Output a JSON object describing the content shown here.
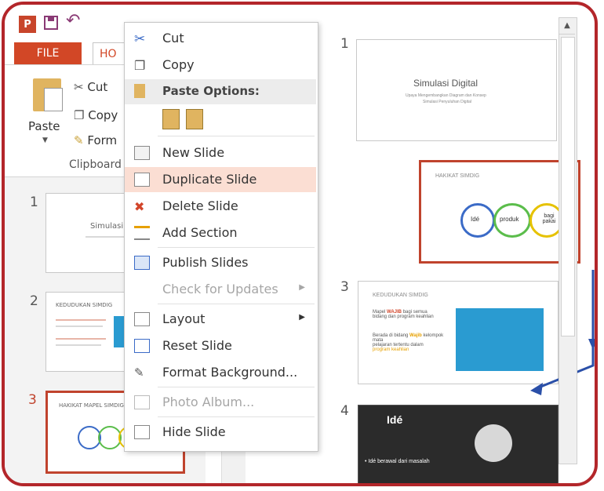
{
  "quick_access": {
    "logo": "P",
    "undo": "↶"
  },
  "tabs": {
    "file": "FILE",
    "home": "HO"
  },
  "ribbon": {
    "paste": "Paste",
    "cut": "Cut",
    "copy": "Copy",
    "format": "Form",
    "group": "Clipboard"
  },
  "left_thumbs": [
    {
      "num": "1",
      "title": "Simulasi D"
    },
    {
      "num": "2",
      "title": "KEDUDUKAN SIMDIG"
    },
    {
      "num": "3",
      "title": "HAKIKAT MAPEL SIMDIG"
    }
  ],
  "context_menu": {
    "items": [
      {
        "label": "Cut",
        "icon": "scissors-icon"
      },
      {
        "label": "Copy",
        "icon": "copy-icon"
      },
      {
        "label": "Paste Options:",
        "icon": "clipboard-icon"
      },
      {
        "label": "New Slide",
        "icon": "new-slide-icon"
      },
      {
        "label": "Duplicate Slide",
        "icon": "duplicate-slide-icon"
      },
      {
        "label": "Delete Slide",
        "icon": "delete-slide-icon"
      },
      {
        "label": "Add Section",
        "icon": "add-section-icon"
      },
      {
        "label": "Publish Slides",
        "icon": "publish-slides-icon"
      },
      {
        "label": "Check for Updates",
        "icon": ""
      },
      {
        "label": "Layout",
        "icon": "layout-icon"
      },
      {
        "label": "Reset Slide",
        "icon": "reset-slide-icon"
      },
      {
        "label": "Format Background...",
        "icon": "format-background-icon"
      },
      {
        "label": "Photo Album...",
        "icon": "photo-album-icon"
      },
      {
        "label": "Hide Slide",
        "icon": "hide-slide-icon"
      }
    ]
  },
  "right_slides": {
    "s1": {
      "num": "1",
      "title": "Simulasi Digital",
      "sub": "Upaya Mengembangkan Diagram dan Konsep",
      "sub2": "Simulasi Penyuluhan Digital"
    },
    "dup": {
      "title": "HAKIKAT SIMDIG",
      "c1": "Idé",
      "c2": "produk",
      "c3": "bagi pakai"
    },
    "s3": {
      "num": "3",
      "title": "KEDUDUKAN SIMDIG",
      "b1a": "Mapel ",
      "b1b": "WAJIB",
      "b1c": " bagi semua",
      "b1d": "bidang dan program keahlian",
      "b2a": "Berada di bidang ",
      "b2b": "Wajib",
      "b2c": "kelompok mata",
      "b2d": "pelajaran tertentu dalam",
      "b2e": "program keahlian"
    },
    "s4": {
      "num": "4",
      "title": "Idé",
      "bullet": "• Idé berawal dari masalah"
    }
  },
  "colors": {
    "accent": "#c0432d",
    "arrow": "#2a4fa8",
    "frame": "#b3262a"
  }
}
